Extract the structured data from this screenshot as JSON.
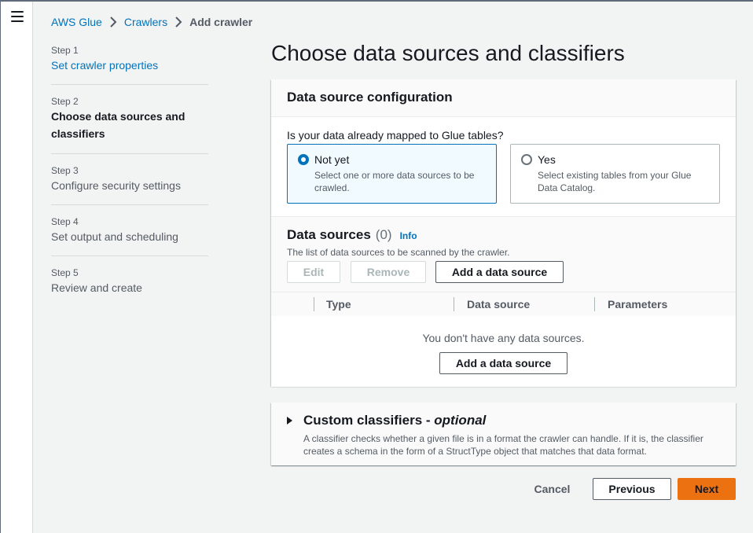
{
  "breadcrumb": {
    "root": "AWS Glue",
    "section": "Crawlers",
    "current": "Add crawler"
  },
  "steps": [
    {
      "label": "Step 1",
      "title": "Set crawler properties"
    },
    {
      "label": "Step 2",
      "title": "Choose data sources and classifiers"
    },
    {
      "label": "Step 3",
      "title": "Configure security settings"
    },
    {
      "label": "Step 4",
      "title": "Set output and scheduling"
    },
    {
      "label": "Step 5",
      "title": "Review and create"
    }
  ],
  "page_title": "Choose data sources and classifiers",
  "data_source_config": {
    "heading": "Data source configuration",
    "question": "Is your data already mapped to Glue tables?",
    "options": [
      {
        "title": "Not yet",
        "description": "Select one or more data sources to be crawled.",
        "selected": true
      },
      {
        "title": "Yes",
        "description": "Select existing tables from your Glue Data Catalog.",
        "selected": false
      }
    ]
  },
  "data_sources": {
    "heading": "Data sources",
    "count": "(0)",
    "info": "Info",
    "description": "The list of data sources to be scanned by the crawler.",
    "edit_label": "Edit",
    "remove_label": "Remove",
    "add_label": "Add a data source",
    "columns": [
      "Type",
      "Data source",
      "Parameters"
    ],
    "empty_text": "You don't have any data sources.",
    "empty_add_label": "Add a data source"
  },
  "custom_classifiers": {
    "title": "Custom classifiers - ",
    "optional": "optional",
    "description": "A classifier checks whether a given file is in a format the crawler can handle. If it is, the classifier creates a schema in the form of a StructType object that matches that data format."
  },
  "footer": {
    "cancel": "Cancel",
    "previous": "Previous",
    "next": "Next"
  },
  "colors": {
    "link": "#0073bb",
    "primary": "#ec7211",
    "selected_tile_bg": "#f1faff"
  }
}
